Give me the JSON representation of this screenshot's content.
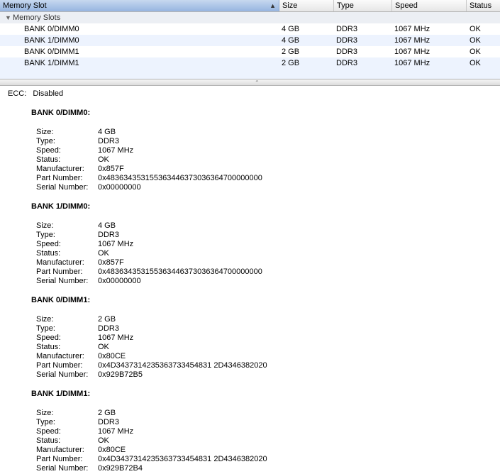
{
  "table": {
    "columns": {
      "slot": "Memory Slot",
      "size": "Size",
      "type": "Type",
      "speed": "Speed",
      "status": "Status"
    },
    "group_label": "Memory Slots",
    "rows": [
      {
        "slot": "BANK 0/DIMM0",
        "size": "4 GB",
        "type": "DDR3",
        "speed": "1067 MHz",
        "status": "OK"
      },
      {
        "slot": "BANK 1/DIMM0",
        "size": "4 GB",
        "type": "DDR3",
        "speed": "1067 MHz",
        "status": "OK"
      },
      {
        "slot": "BANK 0/DIMM1",
        "size": "2 GB",
        "type": "DDR3",
        "speed": "1067 MHz",
        "status": "OK"
      },
      {
        "slot": "BANK 1/DIMM1",
        "size": "2 GB",
        "type": "DDR3",
        "speed": "1067 MHz",
        "status": "OK"
      }
    ]
  },
  "details": {
    "ecc_label": "ECC:",
    "ecc_value": "Disabled",
    "labels": {
      "size": "Size:",
      "type": "Type:",
      "speed": "Speed:",
      "status": "Status:",
      "manufacturer": "Manufacturer:",
      "part_number": "Part Number:",
      "serial_number": "Serial Number:"
    },
    "banks": [
      {
        "title": "BANK 0/DIMM0:",
        "size": "4 GB",
        "type": "DDR3",
        "speed": "1067 MHz",
        "status": "OK",
        "manufacturer": "0x857F",
        "part_number": "0x483634353155363446373036364700000000",
        "serial_number": "0x00000000"
      },
      {
        "title": "BANK 1/DIMM0:",
        "size": "4 GB",
        "type": "DDR3",
        "speed": "1067 MHz",
        "status": "OK",
        "manufacturer": "0x857F",
        "part_number": "0x483634353155363446373036364700000000",
        "serial_number": "0x00000000"
      },
      {
        "title": "BANK 0/DIMM1:",
        "size": "2 GB",
        "type": "DDR3",
        "speed": "1067 MHz",
        "status": "OK",
        "manufacturer": "0x80CE",
        "part_number": "0x4D3437314235363733454831 2D4346382020",
        "serial_number": "0x929B72B5"
      },
      {
        "title": "BANK 1/DIMM1:",
        "size": "2 GB",
        "type": "DDR3",
        "speed": "1067 MHz",
        "status": "OK",
        "manufacturer": "0x80CE",
        "part_number": "0x4D3437314235363733454831 2D4346382020",
        "serial_number": "0x929B72B4"
      }
    ]
  },
  "icons": {
    "sort": "sort-ascending-icon",
    "disclosure": "disclosure-triangle-icon",
    "grip": "splitter-grip-icon"
  }
}
